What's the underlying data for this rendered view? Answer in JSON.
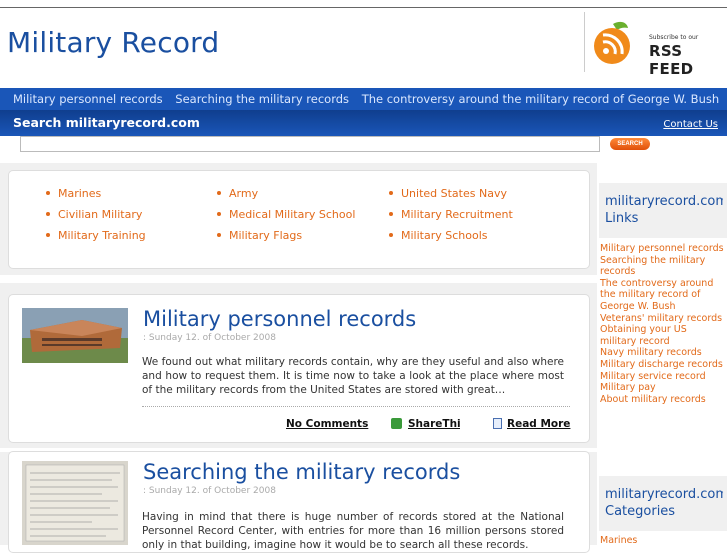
{
  "site": {
    "title": "Military Record"
  },
  "rss": {
    "subscribe": "Subscribe to our",
    "feed": "RSS FEED"
  },
  "nav": {
    "items": [
      "Military personnel records",
      "Searching the military records",
      "The controversy around the military record of George W. Bush"
    ]
  },
  "search": {
    "label": "Search militaryrecord.com",
    "button": "SEARCH",
    "placeholder": "",
    "contact": "Contact Us"
  },
  "categories_top": [
    [
      "Marines",
      "Civilian Military",
      "Military Training"
    ],
    [
      "Army",
      "Medical Military School",
      "Military Flags"
    ],
    [
      "United States Navy",
      "Military Recruitment",
      "Military Schools"
    ]
  ],
  "posts": [
    {
      "title": "Military personnel records",
      "date": ": Sunday 12. of October 2008",
      "body": "We found out what military records contain, why are they useful and also where and how to request them. It is time now to take a look at the place where most of the military records from the United States are stored with great…",
      "comments": "No Comments",
      "share": "ShareThis",
      "read_more": "Read More"
    },
    {
      "title": "Searching the military records",
      "date": ": Sunday 12. of October 2008",
      "body": "Having in mind that there is huge number of records stored at the National Personnel Record Center, with entries for more than 16 million persons stored only in that building, imagine how it would be to search all these records."
    }
  ],
  "sidebar": {
    "links_title": "militaryrecord.com Links",
    "links": [
      "Military personnel records",
      "Searching the military records",
      "The controversy around the military record of George W. Bush",
      "Veterans' military records",
      "Obtaining your US military record",
      "Navy military records",
      "Military discharge records",
      "Military service record",
      "Military pay",
      "About military records"
    ],
    "categories_title": "militaryrecord.com Categories",
    "first_category": "Marines"
  },
  "colors": {
    "brand_blue": "#1a4fa0",
    "nav_blue": "#1a56b8",
    "accent_orange": "#e26a1a"
  }
}
